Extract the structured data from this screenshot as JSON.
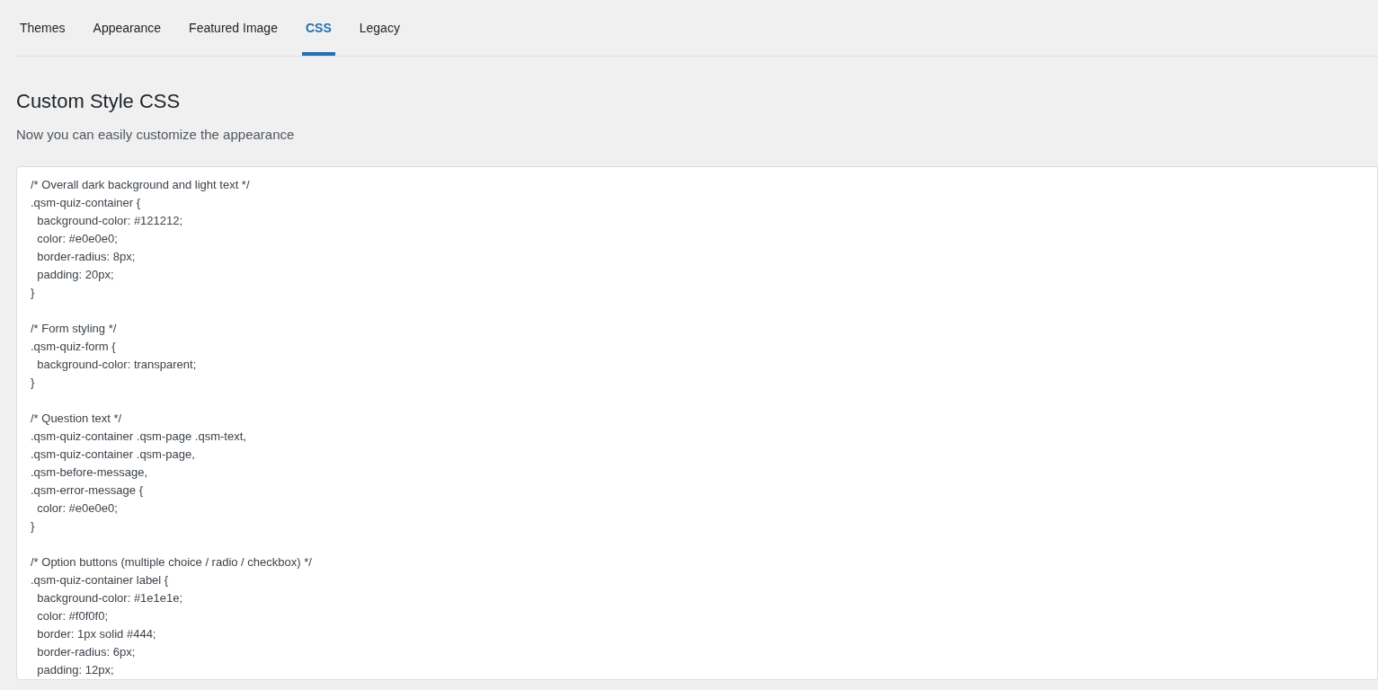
{
  "tabs": [
    {
      "label": "Themes",
      "selected": false
    },
    {
      "label": "Appearance",
      "selected": false
    },
    {
      "label": "Featured Image",
      "selected": false
    },
    {
      "label": "CSS",
      "selected": true
    },
    {
      "label": "Legacy",
      "selected": false
    }
  ],
  "heading": "Custom Style CSS",
  "description": "Now you can easily customize the appearance",
  "css_editor": {
    "blocks": [
      [
        "/* Overall dark background and light text */",
        ".qsm-quiz-container {",
        "  background-color: #121212;",
        "  color: #e0e0e0;",
        "  border-radius: 8px;",
        "  padding: 20px;",
        "}"
      ],
      [
        "/* Form styling */",
        ".qsm-quiz-form {",
        "  background-color: transparent;",
        "}"
      ],
      [
        "/* Question text */",
        ".qsm-quiz-container .qsm-page .qsm-text,",
        ".qsm-quiz-container .qsm-page,",
        ".qsm-before-message,",
        ".qsm-error-message {",
        "  color: #e0e0e0;",
        "}"
      ],
      [
        "/* Option buttons (multiple choice / radio / checkbox) */",
        ".qsm-quiz-container label {",
        "  background-color: #1e1e1e;",
        "  color: #f0f0f0;",
        "  border: 1px solid #444;",
        "  border-radius: 6px;",
        "  padding: 12px;"
      ]
    ]
  }
}
